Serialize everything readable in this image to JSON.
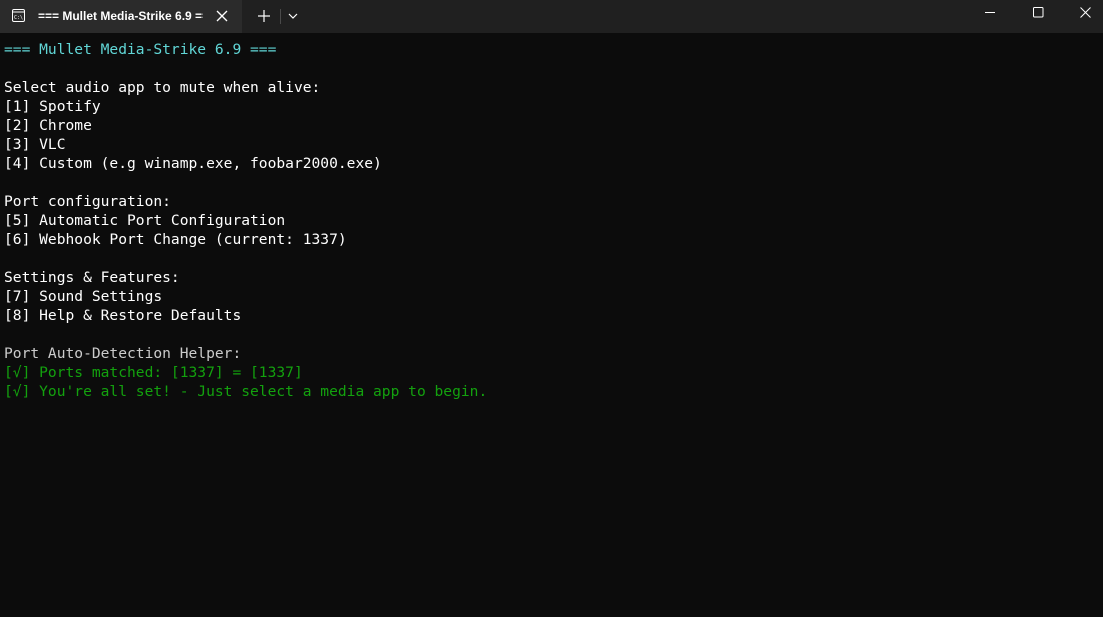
{
  "window": {
    "tab_title": "=== Mullet Media-Strike 6.9 ===",
    "icon": "terminal-icon"
  },
  "terminal": {
    "lines": [
      {
        "text": "=== Mullet Media-Strike 6.9 ===",
        "color": "#61d6d6"
      },
      {
        "text": "",
        "color": "#ffffff"
      },
      {
        "text": "Select audio app to mute when alive:",
        "color": "#ffffff"
      },
      {
        "text": "[1] Spotify",
        "color": "#ffffff"
      },
      {
        "text": "[2] Chrome",
        "color": "#ffffff"
      },
      {
        "text": "[3] VLC",
        "color": "#ffffff"
      },
      {
        "text": "[4] Custom (e.g winamp.exe, foobar2000.exe)",
        "color": "#ffffff"
      },
      {
        "text": "",
        "color": "#ffffff"
      },
      {
        "text": "Port configuration:",
        "color": "#ffffff"
      },
      {
        "text": "[5] Automatic Port Configuration",
        "color": "#ffffff"
      },
      {
        "text": "[6] Webhook Port Change (current: 1337)",
        "color": "#ffffff"
      },
      {
        "text": "",
        "color": "#ffffff"
      },
      {
        "text": "Settings & Features:",
        "color": "#ffffff"
      },
      {
        "text": "[7] Sound Settings",
        "color": "#ffffff"
      },
      {
        "text": "[8] Help & Restore Defaults",
        "color": "#ffffff"
      },
      {
        "text": "",
        "color": "#ffffff"
      },
      {
        "text": "Port Auto-Detection Helper:",
        "color": "#cccccc"
      },
      {
        "text": "[√] Ports matched: [1337] = [1337]",
        "color": "#13a10e"
      },
      {
        "text": "[√] You're all set! - Just select a media app to begin.",
        "color": "#13a10e"
      }
    ]
  }
}
